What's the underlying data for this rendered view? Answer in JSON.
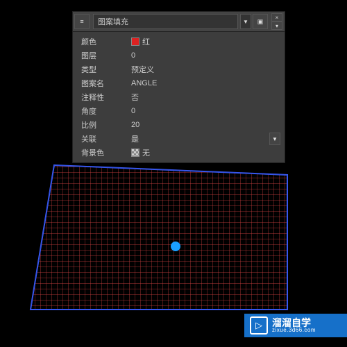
{
  "panel": {
    "title": "图案填充",
    "rows": [
      {
        "label": "颜色",
        "value": "红",
        "swatch": "red"
      },
      {
        "label": "图层",
        "value": "0"
      },
      {
        "label": "类型",
        "value": "预定义"
      },
      {
        "label": "图案名",
        "value": "ANGLE"
      },
      {
        "label": "注释性",
        "value": "否"
      },
      {
        "label": "角度",
        "value": "0"
      },
      {
        "label": "比例",
        "value": "20"
      },
      {
        "label": "关联",
        "value": "是",
        "dropdown": true
      },
      {
        "label": "背景色",
        "value": "无",
        "swatch": "checker"
      }
    ]
  },
  "watermark": {
    "main": "溜溜自学",
    "sub": "zixue.3d66.com"
  }
}
